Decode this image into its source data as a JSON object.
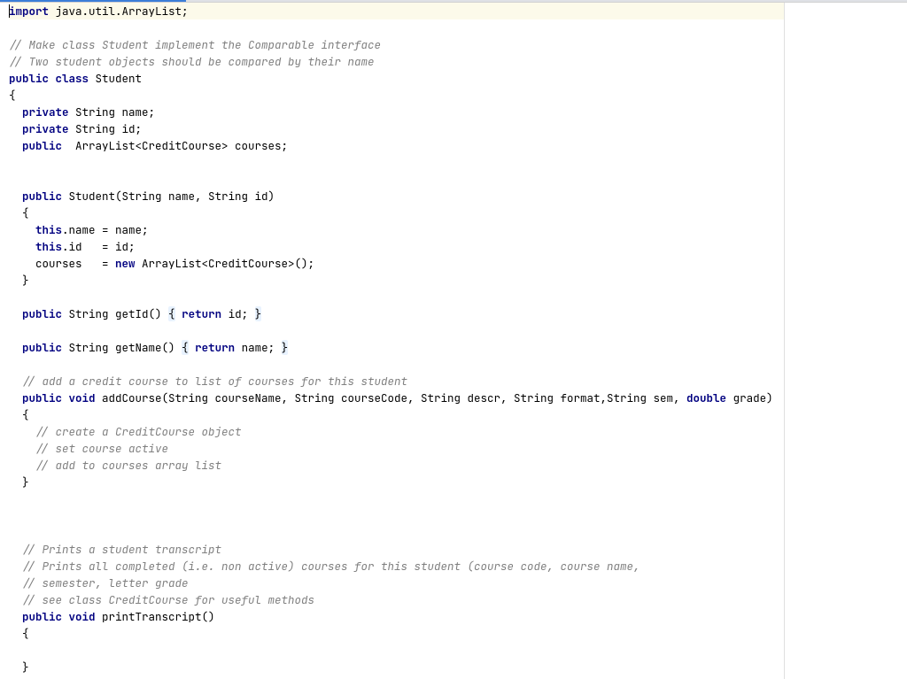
{
  "code": {
    "l01": {
      "a": "import",
      "b": " java.util.ArrayList;"
    },
    "l03": "// Make class Student implement the Comparable interface",
    "l04": "// Two student objects should be compared by their name",
    "l05": {
      "a": "public class",
      "b": " Student"
    },
    "l06": "{",
    "l07": {
      "a": "  ",
      "b": "private",
      "c": " String name;"
    },
    "l08": {
      "a": "  ",
      "b": "private",
      "c": " String id;"
    },
    "l09": {
      "a": "  ",
      "b": "public",
      "c": "  ArrayList<CreditCourse> courses;"
    },
    "l12": {
      "a": "  ",
      "b": "public",
      "c": " Student(String name, String id)"
    },
    "l13": "  {",
    "l14": {
      "a": "    ",
      "b": "this",
      "c": ".name = name;"
    },
    "l15": {
      "a": "    ",
      "b": "this",
      "c": ".id   = id;"
    },
    "l16": {
      "a": "    courses   = ",
      "b": "new",
      "c": " ArrayList<CreditCourse>();"
    },
    "l17": "  }",
    "l19": {
      "a": "  ",
      "b": "public",
      "c": " String getId() ",
      "d": "{",
      "e": " ",
      "f": "return",
      "g": " id; ",
      "h": "}"
    },
    "l21": {
      "a": "  ",
      "b": "public",
      "c": " String getName() ",
      "d": "{",
      "e": " ",
      "f": "return",
      "g": " name; ",
      "h": "}"
    },
    "l23": {
      "a": "  ",
      "b": "// add a credit course to list of courses for this student"
    },
    "l24": {
      "a": "  ",
      "b": "public void",
      "c": " addCourse(String courseName, String courseCode, String descr, String format,String sem, ",
      "d": "double",
      "e": " grade)"
    },
    "l25": "  {",
    "l26": {
      "a": "    ",
      "b": "// create a CreditCourse object"
    },
    "l27": {
      "a": "    ",
      "b": "// set course active"
    },
    "l28": {
      "a": "    ",
      "b": "// add to courses array list"
    },
    "l29": "  }",
    "l33": {
      "a": "  ",
      "b": "// Prints a student transcript"
    },
    "l34": {
      "a": "  ",
      "b": "// Prints all completed (i.e. non active) courses for this student (course code, course name,"
    },
    "l35": {
      "a": "  ",
      "b": "// semester, letter grade"
    },
    "l36": {
      "a": "  ",
      "b": "// see class CreditCourse for useful methods"
    },
    "l37": {
      "a": "  ",
      "b": "public void",
      "c": " printTranscript()"
    },
    "l38": "  {",
    "l40": "  }"
  }
}
